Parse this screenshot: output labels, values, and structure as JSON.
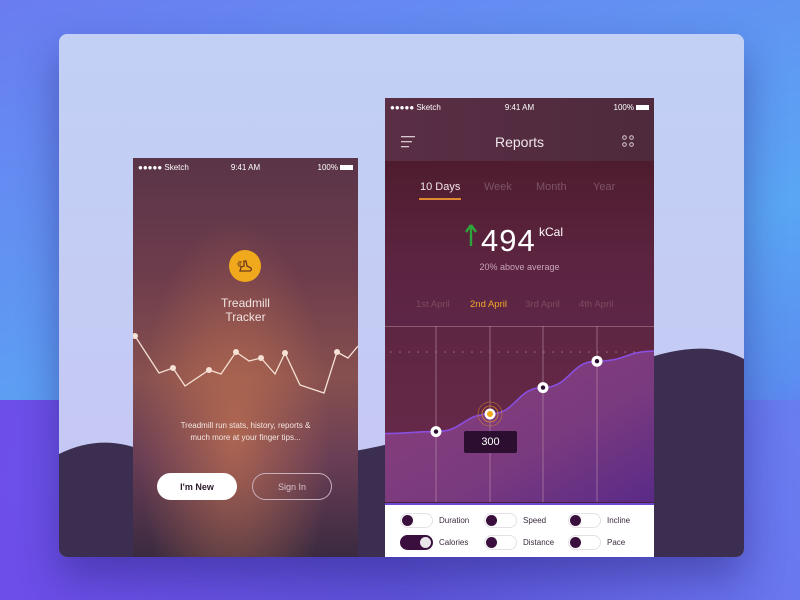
{
  "colors": {
    "accent_orange": "#f0a81c",
    "toggle_on": "#3a0f3e",
    "up_arrow": "#2ea53a",
    "chart_line": "#8a4fe0"
  },
  "left_phone": {
    "status": {
      "carrier": "●●●●● Sketch",
      "time": "9:41 AM",
      "battery": "100%"
    },
    "logo_icon": "running-shoe-icon",
    "app_title_line1": "Treadmill",
    "app_title_line2": "Tracker",
    "tagline_line1": "Treadmill run stats, history, reports &",
    "tagline_line2": "much more at your finger tips...",
    "buttons": {
      "new": "I'm New",
      "sign_in": "Sign In"
    }
  },
  "right_phone": {
    "status": {
      "carrier": "●●●●● Sketch",
      "time": "9:41 AM",
      "battery": "100%"
    },
    "title": "Reports",
    "menu_icon": "menu-icon",
    "grid_icon": "grid-icon",
    "tabs": [
      {
        "label": "10 Days",
        "active": true
      },
      {
        "label": "Week",
        "active": false
      },
      {
        "label": "Month",
        "active": false
      },
      {
        "label": "Year",
        "active": false
      }
    ],
    "summary": {
      "value": "494",
      "unit": "kCal",
      "trend": "up",
      "subtitle": "20% above average"
    },
    "dates": [
      {
        "label": "1st April",
        "active": false
      },
      {
        "label": "2nd April",
        "active": true
      },
      {
        "label": "3rd April",
        "active": false
      },
      {
        "label": "4th April",
        "active": false
      }
    ],
    "tooltip": "300",
    "legend": [
      {
        "label": "Duration",
        "on": false
      },
      {
        "label": "Speed",
        "on": false
      },
      {
        "label": "Incline",
        "on": false
      },
      {
        "label": "Calories",
        "on": true
      },
      {
        "label": "Distance",
        "on": false
      },
      {
        "label": "Pace",
        "on": false
      }
    ]
  },
  "chart_data": {
    "type": "area",
    "title": "Calories",
    "categories": [
      "1st April",
      "2nd April",
      "3rd April",
      "4th April"
    ],
    "series": [
      {
        "name": "Calories",
        "values": [
          240,
          300,
          390,
          480
        ]
      }
    ],
    "highlighted_index": 1,
    "highlight_label": "300",
    "ylim": [
      0,
      600
    ],
    "grid": true
  }
}
